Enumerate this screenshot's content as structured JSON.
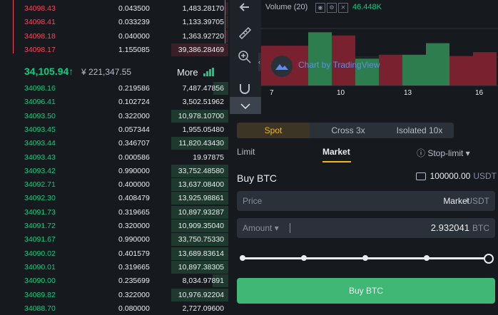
{
  "orderbook": {
    "asks": [
      {
        "price": "34098.43",
        "qty": "0.043500",
        "total": "1,483.28170",
        "depth": 0.05
      },
      {
        "price": "34098.41",
        "qty": "0.033239",
        "total": "1,133.39705",
        "depth": 0.04
      },
      {
        "price": "34098.18",
        "qty": "0.040000",
        "total": "1,363.92720",
        "depth": 0.05
      },
      {
        "price": "34098.17",
        "qty": "1.155085",
        "total": "39,386.28469",
        "depth": 1.0
      }
    ],
    "last_price": "34,105.94",
    "last_arrow": "↑",
    "fiat_price": "¥ 221,347.55",
    "more_label": "More",
    "bids": [
      {
        "price": "34098.16",
        "qty": "0.219586",
        "total": "7,487.47856",
        "depth": 0.26
      },
      {
        "price": "34096.41",
        "qty": "0.102724",
        "total": "3,502.51962",
        "depth": 0.0
      },
      {
        "price": "34093.50",
        "qty": "0.322000",
        "total": "10,978.10700",
        "depth": 1.0
      },
      {
        "price": "34093.45",
        "qty": "0.057344",
        "total": "1,955.05480",
        "depth": 0.0
      },
      {
        "price": "34093.44",
        "qty": "0.346707",
        "total": "11,820.43430",
        "depth": 1.0
      },
      {
        "price": "34093.43",
        "qty": "0.000586",
        "total": "19.97875",
        "depth": 0.0
      },
      {
        "price": "34093.42",
        "qty": "0.990000",
        "total": "33,752.48580",
        "depth": 1.0
      },
      {
        "price": "34092.71",
        "qty": "0.400000",
        "total": "13,637.08400",
        "depth": 1.0
      },
      {
        "price": "34092.30",
        "qty": "0.408479",
        "total": "13,925.98861",
        "depth": 1.0
      },
      {
        "price": "34091.73",
        "qty": "0.319665",
        "total": "10,897.93287",
        "depth": 1.0
      },
      {
        "price": "34091.72",
        "qty": "0.320000",
        "total": "10,909.35040",
        "depth": 1.0
      },
      {
        "price": "34091.67",
        "qty": "0.990000",
        "total": "33,750.75330",
        "depth": 1.0
      },
      {
        "price": "34090.02",
        "qty": "0.401579",
        "total": "13,689.83614",
        "depth": 1.0
      },
      {
        "price": "34090.01",
        "qty": "0.319665",
        "total": "10,897.38305",
        "depth": 1.0
      },
      {
        "price": "34090.00",
        "qty": "0.235699",
        "total": "8,034.97891",
        "depth": 0.27
      },
      {
        "price": "34089.82",
        "qty": "0.322000",
        "total": "10,976.92204",
        "depth": 1.0
      },
      {
        "price": "34088.70",
        "qty": "0.080000",
        "total": "2,727.09600",
        "depth": 0.0
      }
    ]
  },
  "chart": {
    "volume_label": "Volume (20)",
    "volume_value": "46.448K",
    "tradingview_label": "Chart by TradingView",
    "x_ticks": [
      "7",
      "10",
      "13",
      "16"
    ],
    "volume_bars": [
      {
        "h": 0.62,
        "color": "#7a2130"
      },
      {
        "h": 0.62,
        "color": "#7a2130"
      },
      {
        "h": 0.83,
        "color": "#2e7d4f"
      },
      {
        "h": 0.78,
        "color": "#7a2130"
      },
      {
        "h": 0.42,
        "color": "#2e7d4f"
      },
      {
        "h": 0.48,
        "color": "#7a2130"
      },
      {
        "h": 0.48,
        "color": "#2e7d4f"
      },
      {
        "h": 0.66,
        "color": "#2e7d4f"
      },
      {
        "h": 0.46,
        "color": "#7a2130"
      },
      {
        "h": 0.52,
        "color": "#7a2130"
      }
    ]
  },
  "toolbar": {
    "icons": [
      "back-arrow-icon",
      "ruler-icon",
      "zoom-in-icon",
      "magnet-icon",
      "chevron-down-icon"
    ]
  },
  "trade": {
    "modes": [
      {
        "label": "Spot",
        "active": true
      },
      {
        "label": "Cross 3x",
        "active": false
      },
      {
        "label": "Isolated 10x",
        "active": false
      }
    ],
    "order_tabs": [
      "Limit",
      "Market",
      "ⓘ Stop-limit ▾"
    ],
    "active_tab": "Market",
    "buy_title": "Buy BTC",
    "balance": "100000.00",
    "balance_unit": "USDT",
    "price_label": "Price",
    "price_value": "Market",
    "price_unit": "USDT",
    "amount_label": "Amount ▾",
    "amount_value": "2.932041",
    "amount_unit": "BTC",
    "slider_level": 1.0,
    "buy_button": "Buy BTC"
  },
  "colors": {
    "ask": "#f6465d",
    "bid": "#0ecb81",
    "accent": "#f0b90b",
    "buy": "#41b775"
  }
}
